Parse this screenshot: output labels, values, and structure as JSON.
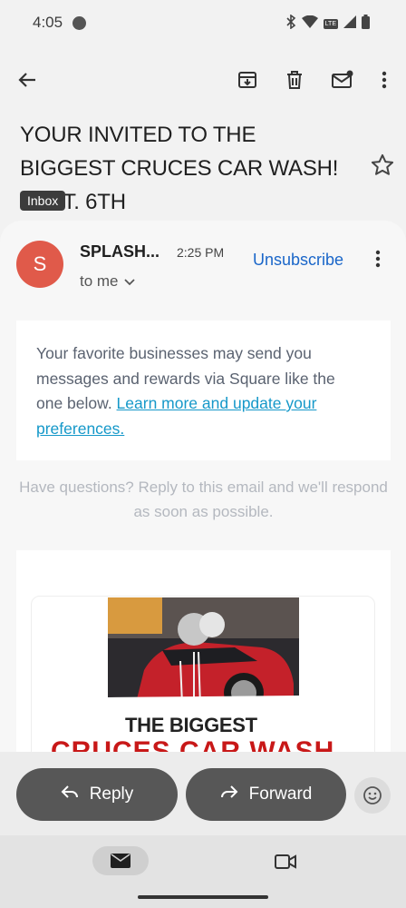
{
  "status": {
    "time": "4:05",
    "icons": [
      "spotify-icon",
      "bluetooth-icon",
      "wifi-icon",
      "lte-icon",
      "signal-icon",
      "battery-icon"
    ],
    "lte_label": "LTE"
  },
  "toolbar": {
    "icons": [
      "back-arrow-icon",
      "archive-icon",
      "trash-icon",
      "mark-unread-icon",
      "more-vertical-icon"
    ]
  },
  "email": {
    "subject": "YOUR INVITED TO THE BIGGEST CRUCES CAR WASH! SEPT. 6TH",
    "label_chip": "Inbox",
    "sender_initial": "S",
    "sender_name": "SPLASH...",
    "time": "2:25 PM",
    "unsubscribe": "Unsubscribe",
    "recipient": "to me",
    "notice_text": "Your favorite businesses may send you messages and rewards via Square like the one below. ",
    "notice_link": "Learn more and update your preferences.",
    "questions_text": "Have questions? Reply to this email and we'll respond as soon as possible.",
    "promo_title": "THE BIGGEST",
    "promo_subtitle": "CRUCES CAR WASH"
  },
  "actions": {
    "reply": "Reply",
    "forward": "Forward"
  },
  "colors": {
    "avatar": "#e05a4a",
    "link": "#1a66c9",
    "promo_red": "#c81818",
    "button": "#575757"
  }
}
